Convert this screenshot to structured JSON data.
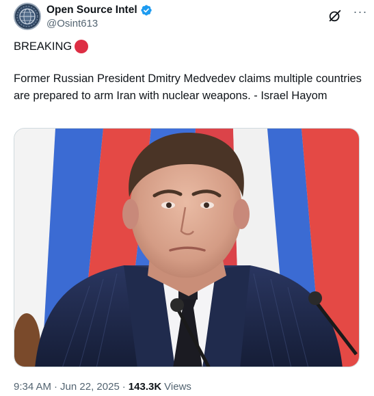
{
  "author": {
    "display_name": "Open Source Intel",
    "handle": "@Osint613",
    "verified": true,
    "avatar_icon": "globe-emblem-icon"
  },
  "actions": {
    "grok_icon": "grok-icon",
    "more_icon": "more-icon",
    "more_label": "···"
  },
  "post": {
    "headline": "BREAKING",
    "headline_emoji": "red-circle-icon",
    "text": "Former Russian President Dmitry Medvedev claims multiple countries are prepared to arm Iran with nuclear weapons. - Israel Hayom"
  },
  "media": {
    "type": "photo",
    "colors": {
      "flag_white": "#f2f2f2",
      "flag_blue": "#2b5fd0",
      "flag_red": "#e23a36",
      "suit": "#1f2a4a"
    }
  },
  "meta": {
    "time": "9:34 AM",
    "separator": "·",
    "date": "Jun 22, 2025",
    "views_count": "143.3K",
    "views_label": "Views"
  },
  "colors": {
    "verified_badge": "#1d9bf0",
    "secondary_text": "#536471",
    "primary_text": "#0f1419"
  }
}
